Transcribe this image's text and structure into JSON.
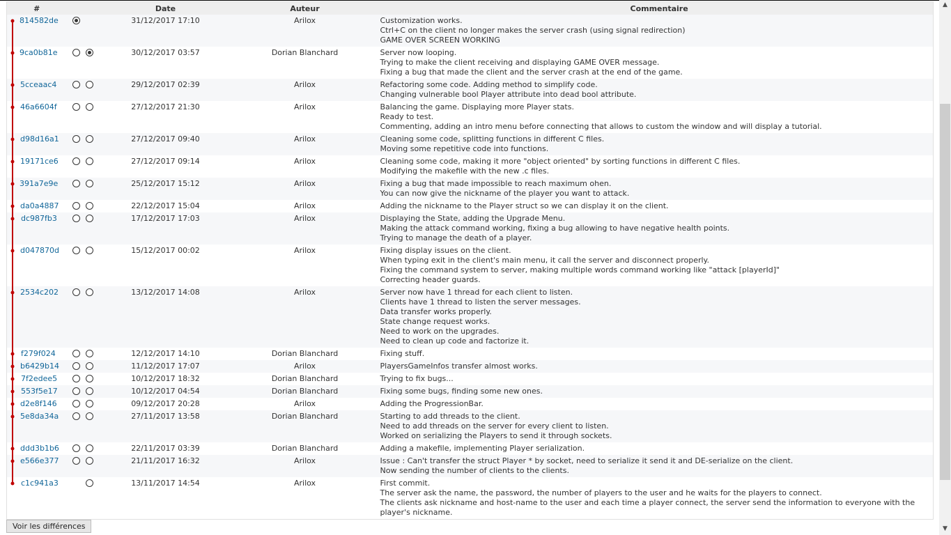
{
  "table": {
    "headers": {
      "id": "#",
      "date": "Date",
      "author": "Auteur",
      "comments": "Commentaire"
    },
    "graph_color": "#c00000",
    "link_color": "#116699",
    "rows": [
      {
        "id": "814582de",
        "radio1": "checked",
        "radio2": "none",
        "date": "31/12/2017 17:10",
        "author": "Arilox",
        "comments": [
          "Customization works.",
          "Ctrl+C on the client no longer makes the server crash (using signal redirection)",
          "GAME OVER SCREEN WORKING"
        ]
      },
      {
        "id": "9ca0b81e",
        "radio1": "unchecked",
        "radio2": "checked",
        "date": "30/12/2017 03:57",
        "author": "Dorian Blanchard",
        "comments": [
          "Server now looping.",
          "Trying to make the client receiving and displaying GAME OVER message.",
          "Fixing a bug that made the client and the server crash at the end of the game."
        ]
      },
      {
        "id": "5cceaac4",
        "radio1": "unchecked",
        "radio2": "unchecked",
        "date": "29/12/2017 02:39",
        "author": "Arilox",
        "comments": [
          "Refactoring some code. Adding method to simplify code.",
          "Changing vulnerable bool Player attribute into dead bool attribute."
        ]
      },
      {
        "id": "46a6604f",
        "radio1": "unchecked",
        "radio2": "unchecked",
        "date": "27/12/2017 21:30",
        "author": "Arilox",
        "comments": [
          "Balancing the game. Displaying more Player stats.",
          "Ready to test.",
          "Commenting, adding an intro menu before connecting that allows to custom the window and will display a tutorial."
        ]
      },
      {
        "id": "d98d16a1",
        "radio1": "unchecked",
        "radio2": "unchecked",
        "date": "27/12/2017 09:40",
        "author": "Arilox",
        "comments": [
          "Cleaning some code, splitting functions in different C files.",
          "Moving some repetitive code into functions."
        ]
      },
      {
        "id": "19171ce6",
        "radio1": "unchecked",
        "radio2": "unchecked",
        "date": "27/12/2017 09:14",
        "author": "Arilox",
        "comments": [
          "Cleaning some code, making it more \"object oriented\" by sorting functions in different C files.",
          "Modifying the makefile with the new .c files."
        ]
      },
      {
        "id": "391a7e9e",
        "radio1": "unchecked",
        "radio2": "unchecked",
        "date": "25/12/2017 15:12",
        "author": "Arilox",
        "comments": [
          "Fixing a bug that made impossible to reach maximum ohen.",
          "You can now give the nickname of the player you want to attack."
        ]
      },
      {
        "id": "da0a4887",
        "radio1": "unchecked",
        "radio2": "unchecked",
        "date": "22/12/2017 15:04",
        "author": "Arilox",
        "comments": [
          "Adding the nickname to the Player struct so we can display it on the client."
        ]
      },
      {
        "id": "dc987fb3",
        "radio1": "unchecked",
        "radio2": "unchecked",
        "date": "17/12/2017 17:03",
        "author": "Arilox",
        "comments": [
          "Displaying the State, adding the Upgrade Menu.",
          "Making the attack command working, fixing a bug allowing to have negative health points.",
          "Trying to manage the death of a player."
        ]
      },
      {
        "id": "d047870d",
        "radio1": "unchecked",
        "radio2": "unchecked",
        "date": "15/12/2017 00:02",
        "author": "Arilox",
        "comments": [
          "Fixing display issues on the client.",
          "When typing exit in the client's main menu, it call the server and disconnect properly.",
          "Fixing the command system to server, making multiple words command working like \"attack [playerId]\"",
          "Correcting header guards."
        ]
      },
      {
        "id": "2534c202",
        "radio1": "unchecked",
        "radio2": "unchecked",
        "date": "13/12/2017 14:08",
        "author": "Arilox",
        "comments": [
          "Server now have 1 thread for each client to listen.",
          "Clients have 1 thread to listen the server messages.",
          "Data transfer works properly.",
          "State change request works.",
          "Need to work on the upgrades.",
          "Need to clean up code and factorize it."
        ]
      },
      {
        "id": "f279f024",
        "radio1": "unchecked",
        "radio2": "unchecked",
        "date": "12/12/2017 14:10",
        "author": "Dorian Blanchard",
        "comments": [
          "Fixing stuff."
        ]
      },
      {
        "id": "b6429b14",
        "radio1": "unchecked",
        "radio2": "unchecked",
        "date": "11/12/2017 17:07",
        "author": "Arilox",
        "comments": [
          "PlayersGameInfos transfer almost works."
        ]
      },
      {
        "id": "7f2edee5",
        "radio1": "unchecked",
        "radio2": "unchecked",
        "date": "10/12/2017 18:32",
        "author": "Dorian Blanchard",
        "comments": [
          "Trying to fix bugs..."
        ]
      },
      {
        "id": "553f5e17",
        "radio1": "unchecked",
        "radio2": "unchecked",
        "date": "10/12/2017 04:54",
        "author": "Dorian Blanchard",
        "comments": [
          "Fixing some bugs, finding some new ones."
        ]
      },
      {
        "id": "d2e8f146",
        "radio1": "unchecked",
        "radio2": "unchecked",
        "date": "09/12/2017 20:28",
        "author": "Arilox",
        "comments": [
          "Adding the ProgressionBar."
        ]
      },
      {
        "id": "5e8da34a",
        "radio1": "unchecked",
        "radio2": "unchecked",
        "date": "27/11/2017 13:58",
        "author": "Dorian Blanchard",
        "comments": [
          "Starting to add threads to the client.",
          "Need to add threads on the server for every client to listen.",
          "Worked on serializing the Players to send it through sockets."
        ]
      },
      {
        "id": "ddd3b1b6",
        "radio1": "unchecked",
        "radio2": "unchecked",
        "date": "22/11/2017 03:39",
        "author": "Dorian Blanchard",
        "comments": [
          "Adding a makefile, implementing Player serialization."
        ]
      },
      {
        "id": "e566e377",
        "radio1": "unchecked",
        "radio2": "unchecked",
        "date": "21/11/2017 16:32",
        "author": "Arilox",
        "comments": [
          "Issue : Can't transfer the struct Player * by socket, need to serialize it send it and DE-serialize on the client.",
          "Now sending the number of clients to the clients."
        ]
      },
      {
        "id": "c1c941a3",
        "radio1": "none",
        "radio2": "unchecked",
        "date": "13/11/2017 14:54",
        "author": "Arilox",
        "comments": [
          "First commit.",
          "The server ask the name, the password, the number of players to the user and he waits for the players to connect.",
          "The clients ask nickname and host-name to the user and each time a player connect, the server send the information to everyone with the",
          "player's nickname."
        ]
      }
    ]
  },
  "footer": {
    "diff_button": "Voir les différences"
  },
  "scrollbar": {
    "up_icon": "chevron-up-icon",
    "down_icon": "chevron-down-icon"
  }
}
